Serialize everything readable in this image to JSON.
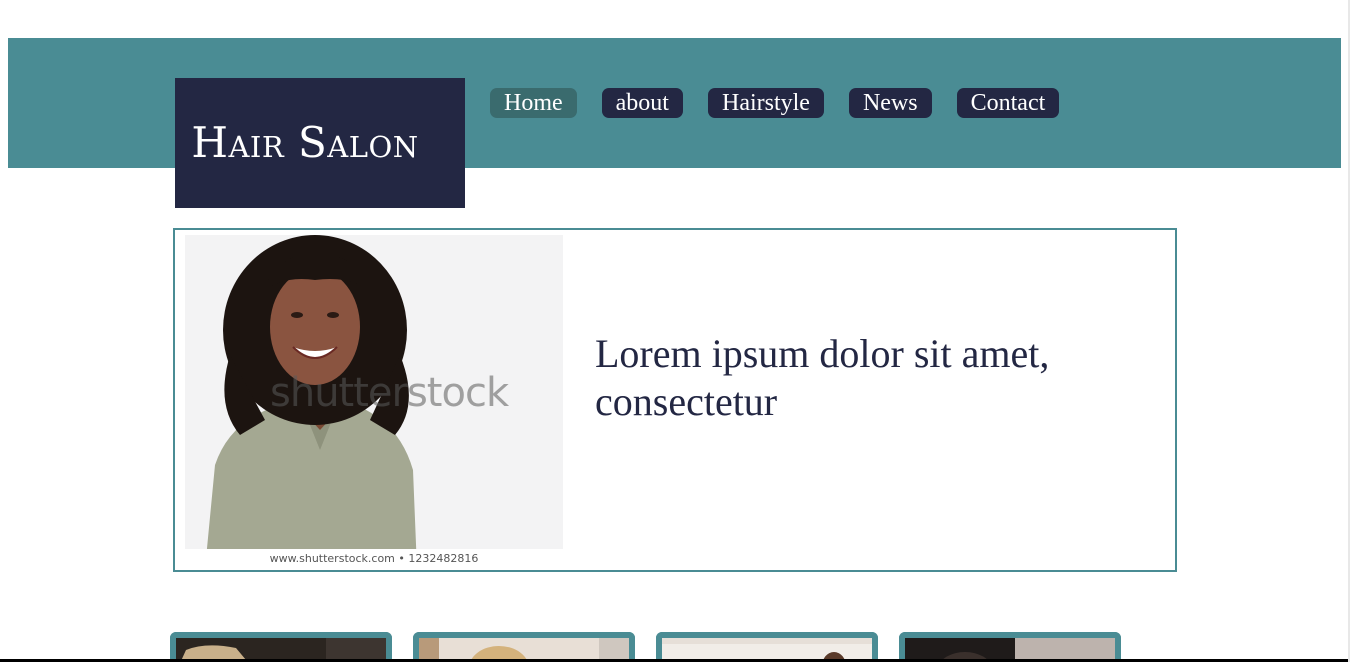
{
  "brand": {
    "logo_text": "Hair Salon"
  },
  "nav": {
    "items": [
      {
        "label": "Home",
        "active": true
      },
      {
        "label": "about",
        "active": false
      },
      {
        "label": "Hairstyle",
        "active": false
      },
      {
        "label": "News",
        "active": false
      },
      {
        "label": "Contact",
        "active": false
      }
    ]
  },
  "hero": {
    "heading": "Lorem ipsum dolor sit amet, consectetur",
    "photo_watermark": "shutterstock",
    "photo_caption": "www.shutterstock.com • 1232482816"
  },
  "colors": {
    "header": "#4a8c94",
    "logo_bg": "#232743",
    "nav_bg": "#232743",
    "nav_active": "#3a6b6e",
    "text": "#232743"
  },
  "thumbnails": [
    {
      "icon": "hair-photo-1"
    },
    {
      "icon": "hair-photo-2"
    },
    {
      "icon": "hair-photo-3"
    },
    {
      "icon": "hair-photo-4"
    }
  ]
}
